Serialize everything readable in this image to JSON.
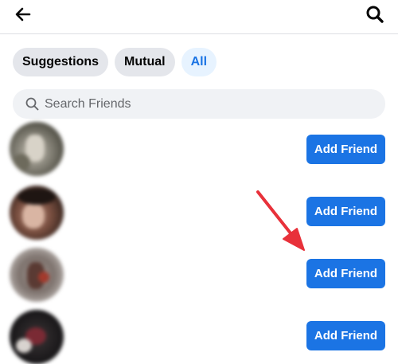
{
  "header": {
    "back_icon": "back-arrow-icon",
    "search_icon": "search-icon"
  },
  "tabs": [
    {
      "label": "Suggestions",
      "active": false
    },
    {
      "label": "Mutual",
      "active": false
    },
    {
      "label": "All",
      "active": true
    }
  ],
  "search": {
    "placeholder": "Search Friends"
  },
  "friends": [
    {
      "button_label": "Add Friend"
    },
    {
      "button_label": "Add Friend"
    },
    {
      "button_label": "Add Friend"
    },
    {
      "button_label": "Add Friend"
    }
  ],
  "colors": {
    "primary": "#1b74e4",
    "chip_bg": "#e4e6eb",
    "chip_active_bg": "#e7f3ff",
    "annotation_arrow": "#e8313a"
  }
}
